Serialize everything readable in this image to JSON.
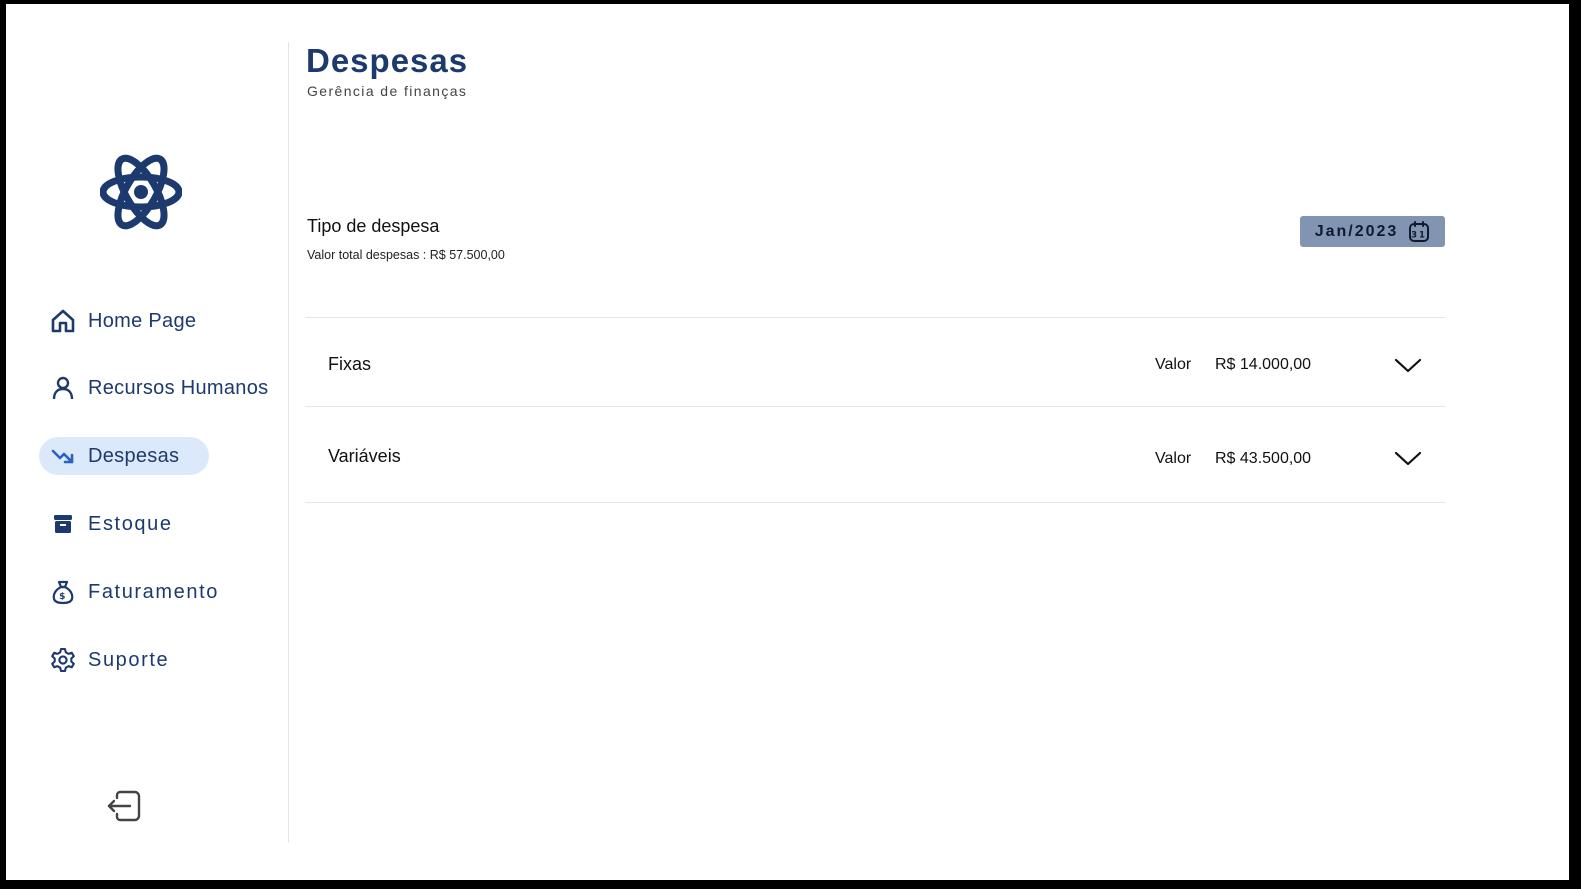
{
  "sidebar": {
    "logo_icon": "atom-logo-icon",
    "items": [
      {
        "label": "Home Page",
        "icon": "home-icon",
        "active": false
      },
      {
        "label": "Recursos Humanos",
        "icon": "user-icon",
        "active": false
      },
      {
        "label": "Despesas",
        "icon": "trending-down-icon",
        "active": true
      },
      {
        "label": "Estoque",
        "icon": "archive-box-icon",
        "active": false
      },
      {
        "label": "Faturamento",
        "icon": "money-bag-icon",
        "active": false
      },
      {
        "label": "Suporte",
        "icon": "gear-icon",
        "active": false
      }
    ],
    "logout_icon": "logout-icon"
  },
  "header": {
    "title": "Despesas",
    "subtitle": "Gerência de finanças"
  },
  "section": {
    "title": "Tipo de despesa",
    "total_text": "Valor total despesas : R$ 57.500,00",
    "date": "Jan/2023",
    "date_icon": "calendar-icon",
    "date_icon_text": "31"
  },
  "expenses": [
    {
      "name": "Fixas",
      "value_label": "Valor",
      "value": "R$ 14.000,00"
    },
    {
      "name": "Variáveis",
      "value_label": "Valor",
      "value": "R$ 43.500,00"
    }
  ],
  "colors": {
    "primary": "#1d3a6e",
    "active_bg": "#dce9fb",
    "badge_bg": "#8195b3"
  }
}
